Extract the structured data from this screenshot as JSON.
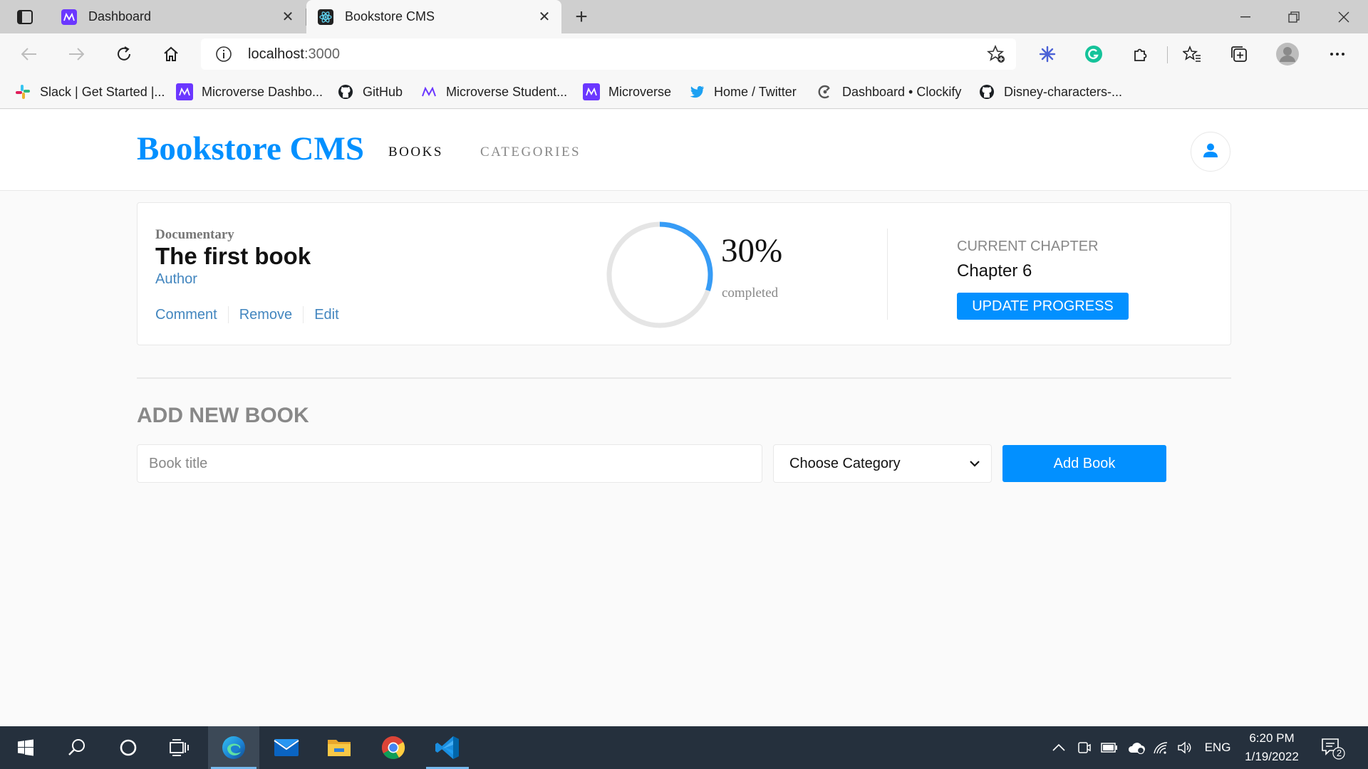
{
  "browser": {
    "tabs": [
      {
        "title": "Dashboard",
        "active": false
      },
      {
        "title": "Bookstore CMS",
        "active": true
      }
    ],
    "address": {
      "host": "localhost",
      "port": ":3000"
    },
    "bookmarks": [
      {
        "label": "Slack | Get Started |...",
        "icon": "slack-icon"
      },
      {
        "label": "Microverse Dashbo...",
        "icon": "microverse-icon"
      },
      {
        "label": "GitHub",
        "icon": "github-icon"
      },
      {
        "label": "Microverse Student...",
        "icon": "microverse-icon"
      },
      {
        "label": "Microverse",
        "icon": "microverse-icon"
      },
      {
        "label": "Home / Twitter",
        "icon": "twitter-icon"
      },
      {
        "label": "Dashboard • Clockify",
        "icon": "clockify-icon"
      },
      {
        "label": "Disney-characters-...",
        "icon": "github-icon"
      }
    ]
  },
  "app": {
    "brand": "Bookstore CMS",
    "nav": {
      "books": "BOOKS",
      "categories": "CATEGORIES"
    },
    "accent_color": "#0290ff"
  },
  "book": {
    "genre": "Documentary",
    "title": "The first book",
    "author": "Author",
    "actions": {
      "comment": "Comment",
      "remove": "Remove",
      "edit": "Edit"
    },
    "progress_fraction": 0.3,
    "percent": "30%",
    "completed_label": "completed",
    "chapter_label": "CURRENT CHAPTER",
    "chapter": "Chapter 6",
    "update_label": "UPDATE PROGRESS"
  },
  "form": {
    "heading": "ADD NEW BOOK",
    "title_placeholder": "Book title",
    "title_value": "",
    "category_selected": "Choose Category",
    "submit_label": "Add Book"
  },
  "taskbar": {
    "apps": [
      "start-icon",
      "search-icon",
      "cortana-icon",
      "task-view-icon",
      "edge-icon",
      "mail-icon",
      "file-explorer-icon",
      "chrome-icon",
      "vscode-icon"
    ],
    "language": "ENG",
    "time": "6:20 PM",
    "date": "1/19/2022",
    "notification_count": "2"
  }
}
